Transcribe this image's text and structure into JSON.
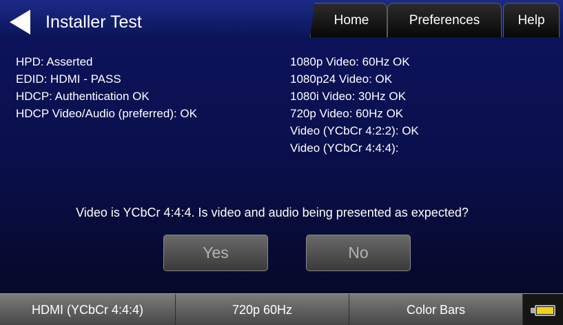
{
  "header": {
    "title": "Installer Test",
    "tabs": [
      {
        "label": "Home"
      },
      {
        "label": "Preferences"
      },
      {
        "label": "Help"
      }
    ]
  },
  "status_left": [
    "HPD: Asserted",
    "EDID: HDMI - PASS",
    "HDCP: Authentication OK",
    "HDCP Video/Audio (preferred): OK"
  ],
  "status_right": [
    "1080p Video: 60Hz OK",
    "1080p24 Video: OK",
    "1080i Video: 30Hz OK",
    "720p Video: 60Hz OK",
    "Video (YCbCr 4:2:2): OK",
    "Video (YCbCr 4:4:4):"
  ],
  "prompt": {
    "question": "Video is YCbCr 4:4:4. Is video and audio being presented as expected?",
    "yes_label": "Yes",
    "no_label": "No"
  },
  "footer": {
    "interface": "HDMI (YCbCr 4:4:4)",
    "format": "720p 60Hz",
    "image": "Color Bars",
    "battery_icon": "battery-icon",
    "battery_level": 1.0,
    "battery_color": "#f3d21a"
  },
  "colors": {
    "background": "#0a0f4a",
    "tab_bg": "#1a1a1a",
    "button_disabled_text": "#b4b4b4"
  }
}
